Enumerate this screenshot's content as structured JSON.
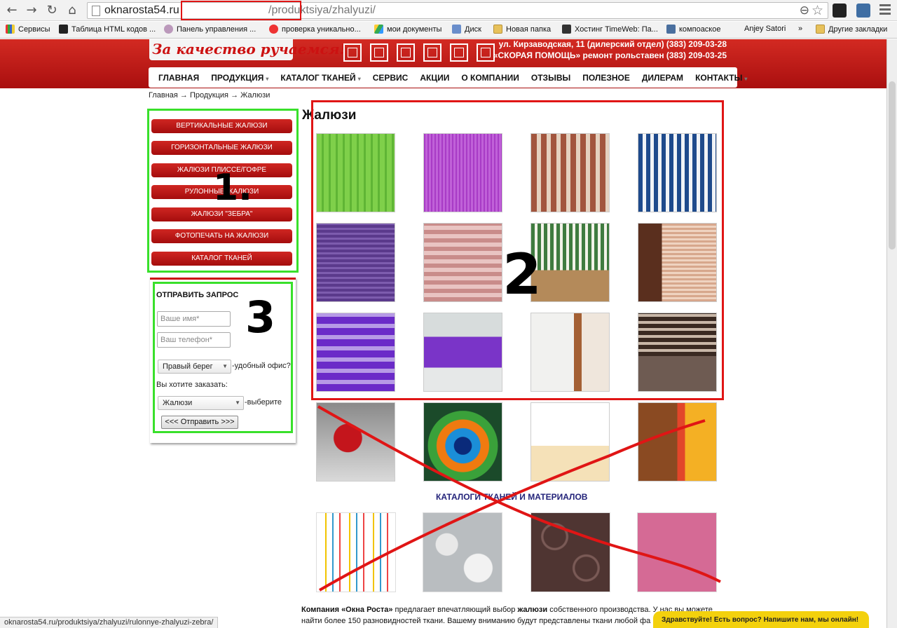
{
  "browser": {
    "url_host": "oknarosta54.ru",
    "url_path": "/produktsiya/zhalyuzi/",
    "status_url": "oknarosta54.ru/produktsiya/zhalyuzi/rulonnye-zhalyuzi-zebra/",
    "bookmarks": [
      {
        "label": "Сервисы",
        "icon": "apps-icon"
      },
      {
        "label": "Таблица HTML кодов ...",
        "icon": "html-icon"
      },
      {
        "label": "Панель управления ...",
        "icon": "panel-icon"
      },
      {
        "label": "проверка уникально...",
        "icon": "copyright-icon"
      },
      {
        "label": "мои документы",
        "icon": "drive-icon"
      },
      {
        "label": "Диск",
        "icon": "disk-icon"
      },
      {
        "label": "Новая папка",
        "icon": "folder-icon"
      },
      {
        "label": "Хостинг TimeWeb: Па...",
        "icon": "timeweb-icon"
      },
      {
        "label": "компоаское",
        "icon": "vk-icon"
      },
      {
        "label": "Anjey Satori",
        "icon": "none"
      },
      {
        "label": "»",
        "icon": "none"
      },
      {
        "label": "Другие закладки",
        "icon": "folder-icon"
      }
    ]
  },
  "header": {
    "logo_text": "За качество ручаемся!",
    "contact_line_1": "ул. Кирзаводская, 11 (дилерский отдел) (383) 209-03-28",
    "contact_line_2": "«СКОРАЯ ПОМОЩЬ» ремонт рольставен (383) 209-03-25",
    "nav": [
      {
        "label": "ГЛАВНАЯ",
        "dropdown": false
      },
      {
        "label": "ПРОДУКЦИЯ",
        "dropdown": true
      },
      {
        "label": "КАТАЛОГ ТКАНЕЙ",
        "dropdown": true
      },
      {
        "label": "СЕРВИС",
        "dropdown": false
      },
      {
        "label": "АКЦИИ",
        "dropdown": false
      },
      {
        "label": "О КОМПАНИИ",
        "dropdown": false
      },
      {
        "label": "ОТЗЫВЫ",
        "dropdown": false
      },
      {
        "label": "ПОЛЕЗНОЕ",
        "dropdown": false
      },
      {
        "label": "ДИЛЕРАМ",
        "dropdown": false
      },
      {
        "label": "КОНТАКТЫ",
        "dropdown": true
      }
    ],
    "caret": "▾"
  },
  "breadcrumb": "Главная → Продукция → Жалюзи",
  "sidebar": {
    "buttons": [
      "ВЕРТИКАЛЬНЫЕ ЖАЛЮЗИ",
      "ГОРИЗОНТАЛЬНЫЕ ЖАЛЮЗИ",
      "ЖАЛЮЗИ ПЛИССЕ/ГОФРЕ",
      "РУЛОННЫЕ ЖАЛЮЗИ",
      "ЖАЛЮЗИ \"ЗЕБРА\"",
      "ФОТОПЕЧАТЬ НА ЖАЛЮЗИ",
      "КАТАЛОГ ТКАНЕЙ"
    ]
  },
  "form": {
    "title": "ОТПРАВИТЬ ЗАПРОС",
    "name_placeholder": "Ваше имя*",
    "phone_placeholder": "Ваш телефон*",
    "office_value": "Правый берег",
    "office_suffix": "-удобный офис?",
    "order_question": "Вы хотите заказать:",
    "order_value": "Жалюзи",
    "order_suffix": "-выберите",
    "submit_label": "<<< Отправить >>>"
  },
  "content": {
    "heading": "Жалюзи",
    "catalog_title": "КАТАЛОГИ ТКАНЕЙ И МАТЕРИАЛОВ",
    "description_bold": "Компания «Окна Роста»",
    "description_1": " предлагает впечатляющий выбор ",
    "description_bold_2": "жалюзи",
    "description_2": " собственного производства. У нас вы можете найти более 150 разновидностей ткани. Вашему вниманию будут представлены ткани любой фа"
  },
  "annotations": {
    "label_1": "1.",
    "label_2": "2",
    "label_3": "3"
  },
  "chat": {
    "text": "Здравствуйте! Есть вопрос? Напишите нам, мы онлайн!"
  },
  "colors": {
    "brand_red": "#c11b17",
    "annot_green": "#39e02b",
    "annot_red": "#e01515",
    "catalog_blue": "#23237a",
    "chat_yellow": "#f3d10d"
  }
}
